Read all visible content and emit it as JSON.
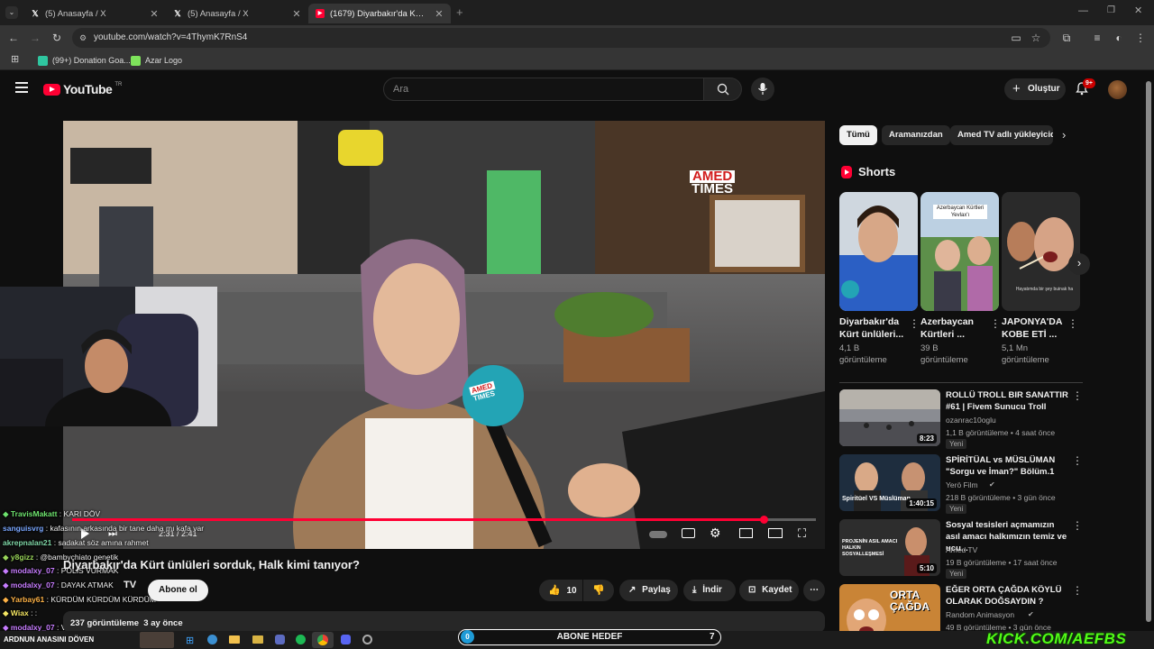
{
  "browser": {
    "tabs": [
      {
        "title": "(5) Anasayfa / X",
        "icon": "x-logo-icon"
      },
      {
        "title": "(5) Anasayfa / X",
        "icon": "x-logo-icon"
      },
      {
        "title": "(1679) Diyarbakır'da Kürt ünlüle",
        "icon": "youtube-icon"
      }
    ],
    "url": "youtube.com/watch?v=4ThymK7RnS4",
    "bookmarks": [
      {
        "label": "(99+) Donation Goa..."
      },
      {
        "label": "Azar Logo"
      }
    ]
  },
  "header": {
    "logo_text": "YouTube",
    "region": "TR",
    "search_placeholder": "Ara",
    "create_label": "Oluştur",
    "notif_count": "9+"
  },
  "video": {
    "brand_line1": "AMED",
    "brand_line2": "TIMES",
    "mic_line1": "AMED",
    "mic_line2": "TIMES",
    "time": "2:31 / 2:41",
    "progress": 0.93,
    "title": "Diyarbakır'da Kürt ünlüleri sorduk, Halk kimi tanıyor?",
    "subscribe_label": "Abone ol",
    "channel_tv": "TV",
    "likes": "10",
    "share_label": "Paylaş",
    "download_label": "İndir",
    "save_label": "Kaydet",
    "views_line": "237 görüntüleme  3 ay önce"
  },
  "chat": [
    {
      "user": "TravisMakatt",
      "msg": ": KARI DÖV",
      "color": "#6ee36e",
      "badge": "◆"
    },
    {
      "user": "sanguisvrg",
      "msg": ": kafasının arkasında bir tane daha mı kafa var",
      "color": "#7aa7ff",
      "badge": ""
    },
    {
      "user": "akrepnalan21",
      "msg": ": sadakat söz amına rahmet",
      "color": "#7fd6a6",
      "badge": ""
    },
    {
      "user": "y8gizz",
      "msg": ": @bambychiato genetik",
      "color": "#9ad65a",
      "badge": "◆"
    },
    {
      "user": "modalxy_07",
      "msg": ": POLİS VURMAK",
      "color": "#c77dff",
      "badge": "◆"
    },
    {
      "user": "modalxy_07",
      "msg": ": DAYAK ATMAK",
      "color": "#c77dff",
      "badge": "◆"
    },
    {
      "user": "Yarbay61",
      "msg": ": KÜRDÜM KÜRDÜM KÜRDÜM",
      "color": "#ffb347",
      "badge": "◆"
    },
    {
      "user": "Wiax",
      "msg": ": :",
      "color": "#f5e663",
      "badge": "◆"
    },
    {
      "user": "modalxy_07",
      "msg": ": VERMEK",
      "color": "#c77dff",
      "badge": "◆"
    },
    {
      "user": "ARDNUN ANASINI DÖVEN",
      "msg": "",
      "color": "#ffffff",
      "badge": ""
    }
  ],
  "filters": [
    "Tümü",
    "Aramanızdan",
    "Amed TV adlı yükleyiciden"
  ],
  "shorts": {
    "heading": "Shorts",
    "items": [
      {
        "title": "Diyarbakır'da Kürt ünlüleri...",
        "views": "4,1 B görüntüleme",
        "caption": ""
      },
      {
        "title": "Azerbaycan Kürtleri ...",
        "views": "39 B görüntüleme",
        "caption": "Azerbaycan Kürtleri Yevlax'ı"
      },
      {
        "title": "JAPONYA'DA KOBE ETİ ...",
        "views": "5,1 Mn görüntüleme",
        "caption": "Hayatımda bir şey buinak ha"
      }
    ]
  },
  "related": [
    {
      "title": "ROLLÜ TROLL BIR SANATTIR #61 | Fivem Sunucu Troll",
      "channel": "ozanrac10oglu",
      "meta": "1,1 B görüntüleme • 4 saat önce",
      "badge": "Yeni",
      "duration": "8:23",
      "thumb_text": ""
    },
    {
      "title": "SPİRİTÜAL vs MÜSLÜMAN \"Sorgu ve İman?\" Bölüm.1",
      "channel": "Yerö Film",
      "meta": "218 B görüntüleme • 3 gün önce",
      "badge": "Yeni",
      "duration": "1:40:15",
      "thumb_text": "Spiritüel VS Müslüman"
    },
    {
      "title": "Sosyal tesisleri açmamızın asıl amacı halkımızın temiz ve ucu...",
      "channel": "Amed TV",
      "meta": "19 B görüntüleme • 17 saat önce",
      "badge": "Yeni",
      "duration": "5:10",
      "thumb_text": "PROJENİN ASIL AMACI HALKIN SOSYALLEŞMESİ"
    },
    {
      "title": "EĞER ORTA ÇAĞDA KÖYLÜ OLARAK DOĞSAYDIN ?",
      "channel": "Random Animasyon",
      "meta": "49 B görüntüleme • 3 gün önce",
      "badge": "",
      "duration": "",
      "thumb_text": "ORTA ÇAĞDA"
    }
  ],
  "overlay": {
    "abone_label": "ABONE HEDEF",
    "abone_current": "0",
    "abone_goal": "7",
    "kick_text": "KICK.COM/AEFBS"
  },
  "colors": {
    "accent": "#ff0033",
    "background": "#0f0f0f",
    "kick_green": "#53fc18"
  }
}
